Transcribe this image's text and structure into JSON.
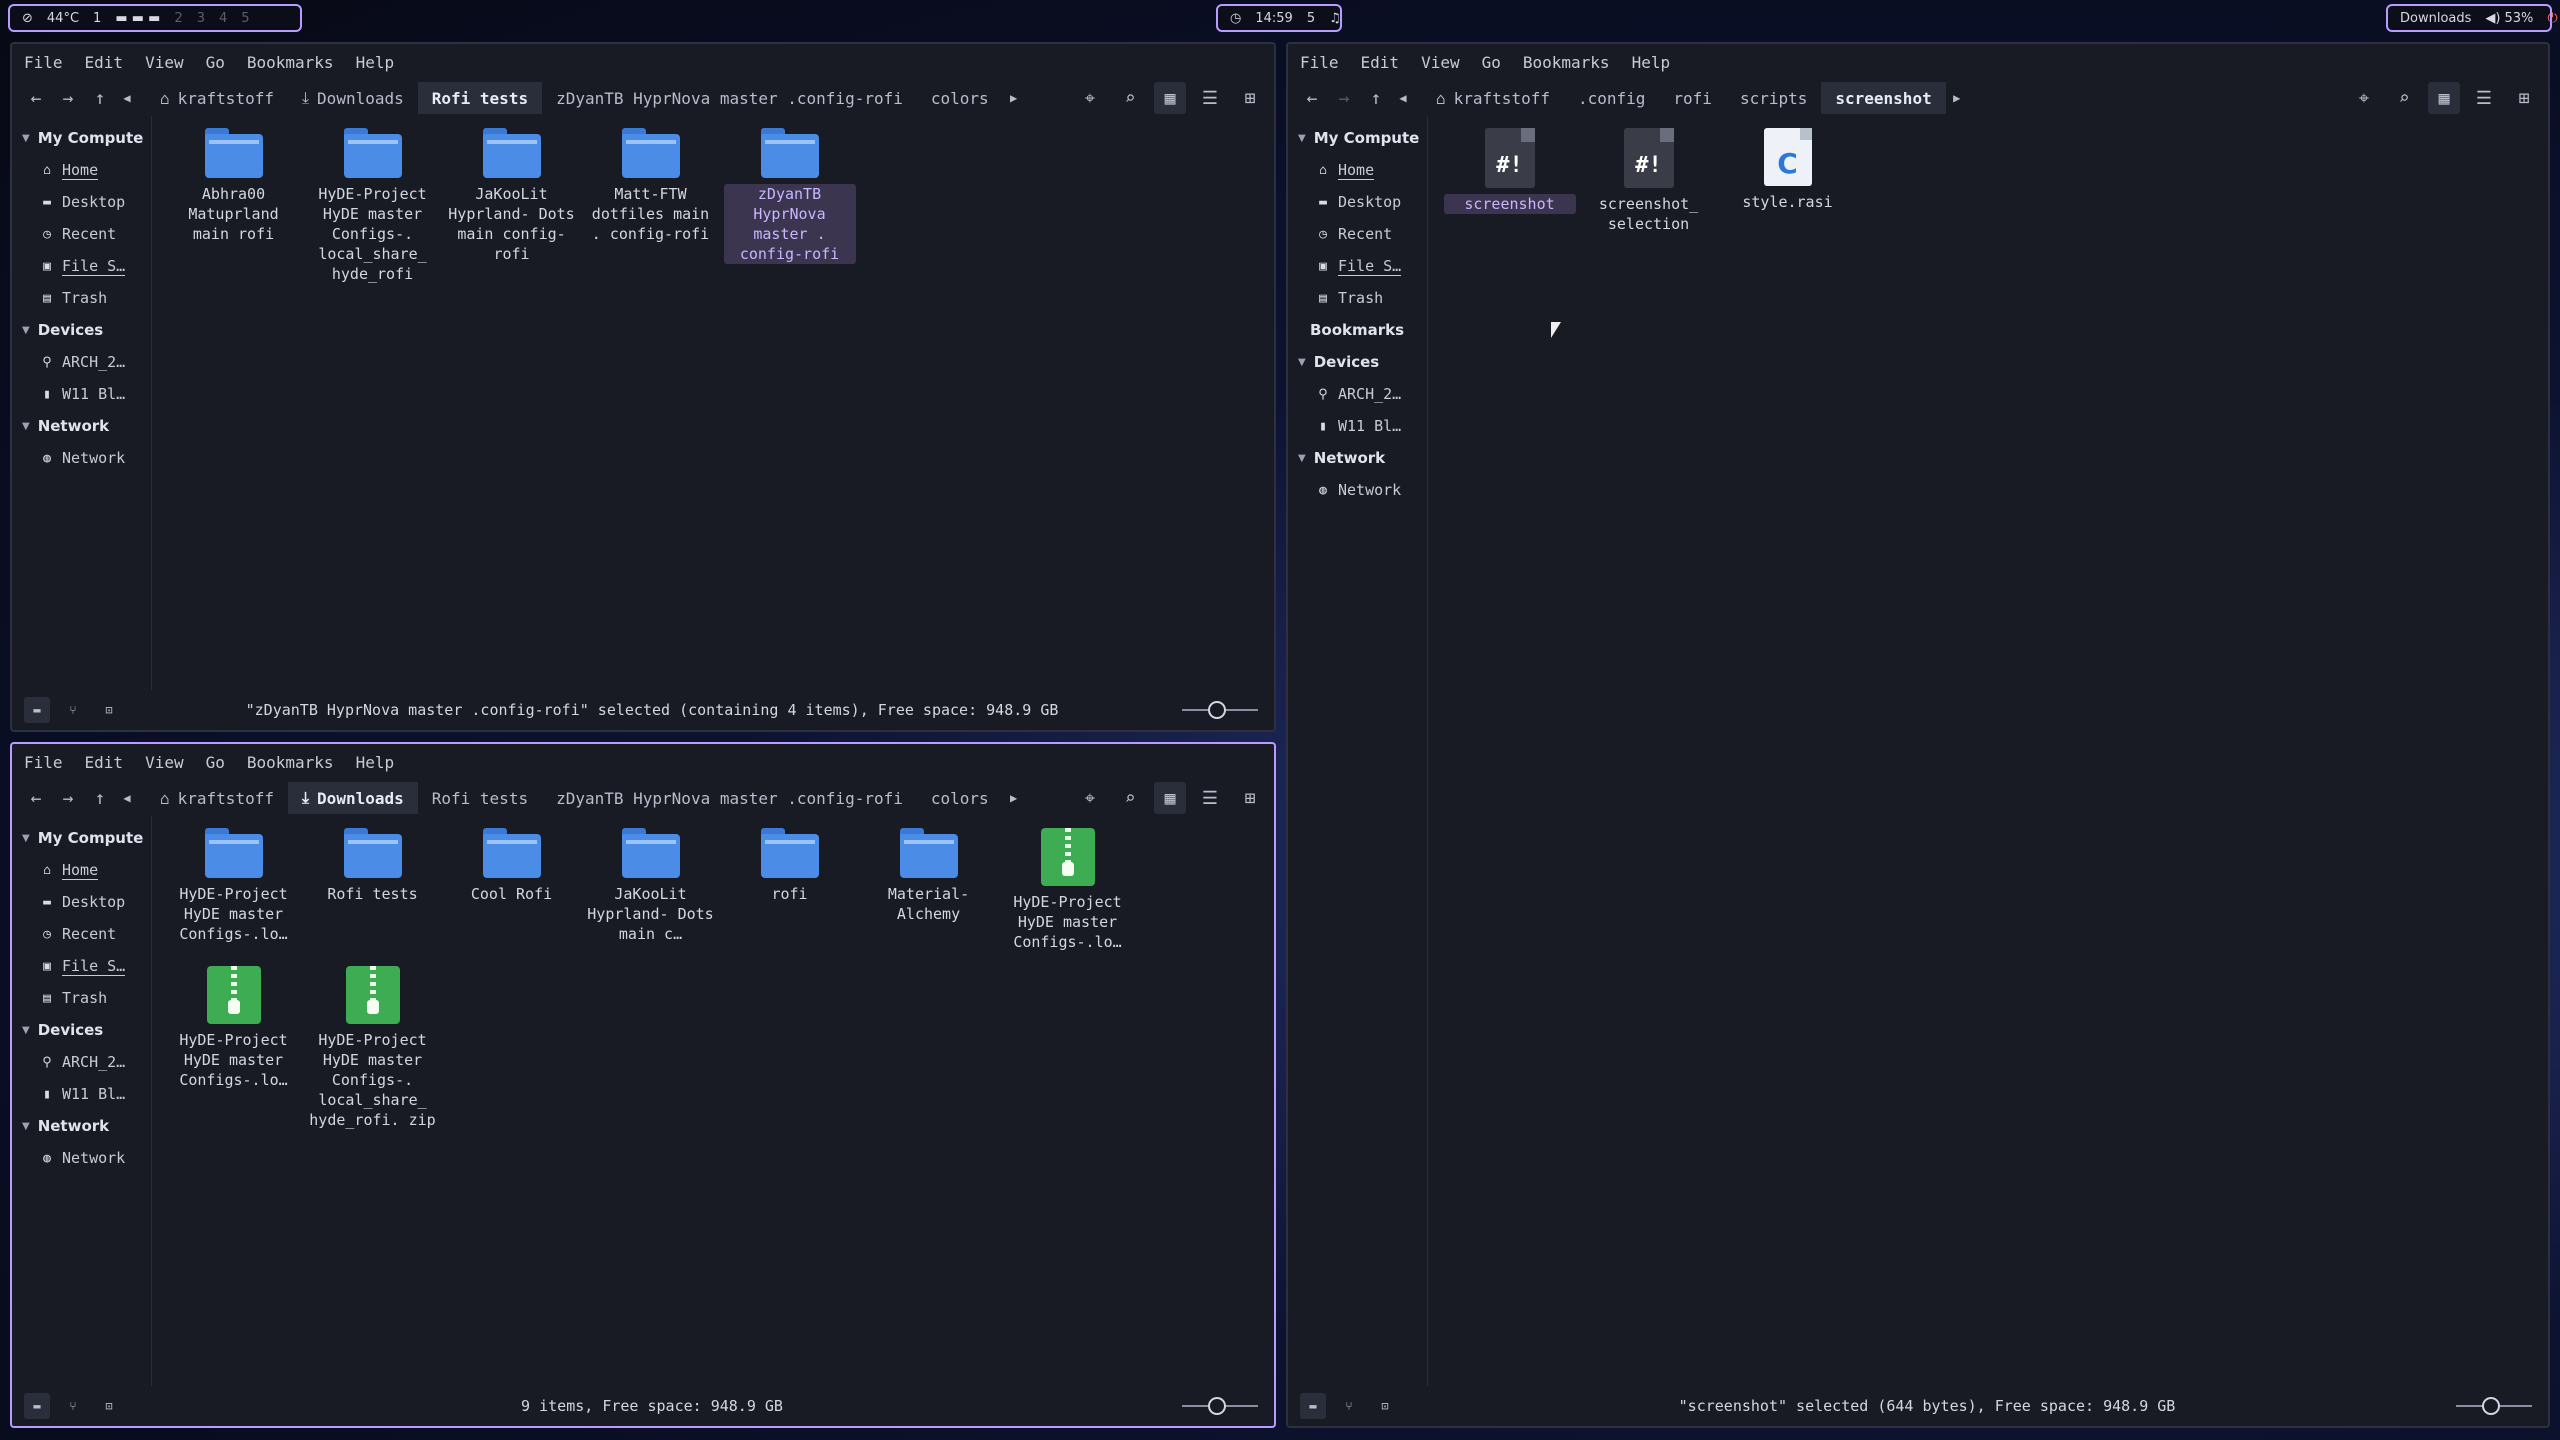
{
  "topbar": {
    "temp": "44°C",
    "workspaces": [
      "1",
      "2",
      "3",
      "4",
      "5"
    ],
    "clock": "14:59",
    "notif": "5",
    "window_title": "Downloads",
    "volume": "53%"
  },
  "menu": [
    "File",
    "Edit",
    "View",
    "Go",
    "Bookmarks",
    "Help"
  ],
  "sidebar_a": {
    "my_computer": "My Compute",
    "places": [
      "Home",
      "Desktop",
      "Recent",
      "File S…",
      "Trash"
    ],
    "devices": "Devices",
    "device_items": [
      "ARCH_2…",
      "W11 Bl…"
    ],
    "network": "Network",
    "network_items": [
      "Network"
    ]
  },
  "sidebar_b": {
    "my_computer": "My Compute",
    "places": [
      "Home",
      "Desktop",
      "Recent",
      "File S…",
      "Trash"
    ],
    "bookmarks": "Bookmarks",
    "devices": "Devices",
    "device_items": [
      "ARCH_2…",
      "W11 Bl…"
    ],
    "network": "Network",
    "network_items": [
      "Network"
    ]
  },
  "win1": {
    "crumbs": [
      "kraftstoff",
      "Downloads",
      "Rofi tests",
      "zDyanTB HyprNova master .config-rofi",
      "colors"
    ],
    "files": [
      {
        "name": "Abhra00 Matuprland main rofi"
      },
      {
        "name": "HyDE-Project HyDE master Configs-. local_share_ hyde_rofi"
      },
      {
        "name": "JaKooLit Hyprland- Dots main config-rofi"
      },
      {
        "name": "Matt-FTW dotfiles main . config-rofi"
      },
      {
        "name": "zDyanTB HyprNova master . config-rofi"
      }
    ],
    "status": "\"zDyanTB HyprNova master .config-rofi\" selected (containing 4 items), Free space: 948.9 GB"
  },
  "win2": {
    "crumbs": [
      "kraftstoff",
      "Downloads",
      "Rofi tests",
      "zDyanTB HyprNova master .config-rofi",
      "colors"
    ],
    "files": [
      {
        "name": "HyDE-Project HyDE master Configs-.lo…"
      },
      {
        "name": "Rofi tests"
      },
      {
        "name": "Cool Rofi"
      },
      {
        "name": "JaKooLit Hyprland- Dots main c…"
      },
      {
        "name": "rofi"
      },
      {
        "name": "Material- Alchemy"
      },
      {
        "name": "HyDE-Project HyDE master Configs-.lo…"
      },
      {
        "name": "HyDE-Project HyDE master Configs-.lo…"
      },
      {
        "name": "HyDE-Project HyDE master Configs-. local_share_ hyde_rofi. zip"
      }
    ],
    "status": "9 items, Free space: 948.9 GB"
  },
  "win3": {
    "crumbs": [
      "kraftstoff",
      ".config",
      "rofi",
      "scripts",
      "screenshot"
    ],
    "files": [
      {
        "name": "screenshot"
      },
      {
        "name": "screenshot_ selection"
      },
      {
        "name": "style.rasi"
      }
    ],
    "status": "\"screenshot\" selected (644 bytes), Free space: 948.9 GB"
  }
}
